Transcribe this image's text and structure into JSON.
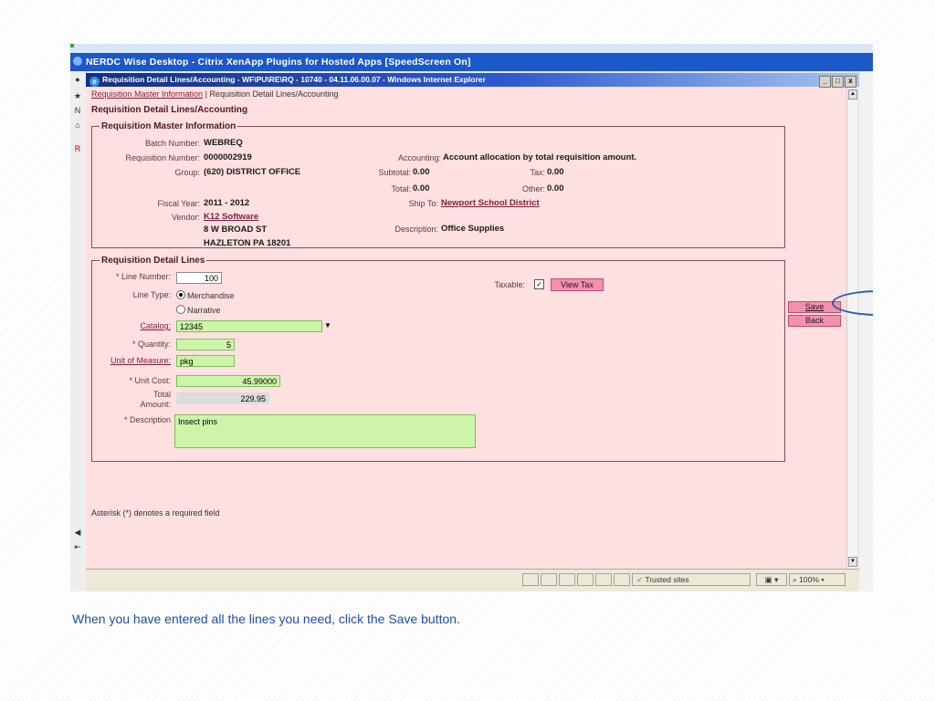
{
  "citrix": {
    "title": "NERDC Wise Desktop - Citrix XenApp Plugins for Hosted Apps [SpeedScreen On]"
  },
  "ie": {
    "title": "Requisition Detail Lines/Accounting - WF\\PU\\RE\\RQ - 10740 - 04.11.06.00.07 - Windows Internet Explorer"
  },
  "breadcrumb": {
    "link": "Requisition Master Information",
    "separator": "|",
    "current": "Requisition Detail Lines/Accounting"
  },
  "page_title": "Requisition Detail Lines/Accounting",
  "master": {
    "legend": "Requisition Master Information",
    "batch_label": "Batch Number:",
    "batch_value": "WEBREQ",
    "reqnum_label": "Requisition Number:",
    "reqnum_value": "0000002919",
    "group_label": "Group:",
    "group_value": "(620) DISTRICT OFFICE",
    "fiscal_label": "Fiscal Year:",
    "fiscal_value": "2011 - 2012",
    "vendor_label": "Vendor:",
    "vendor_value": "K12 Software",
    "vendor_addr1": "8 W BROAD ST",
    "vendor_addr2": "HAZLETON PA 18201",
    "accounting_label": "Accounting:",
    "accounting_value": "Account allocation by total requisition amount.",
    "subtotal_label": "Subtotal:",
    "subtotal_value": "0.00",
    "tax_label": "Tax:",
    "tax_value": "0.00",
    "total_label": "Total:",
    "total_value": "0.00",
    "other_label": "Other:",
    "other_value": "0.00",
    "shipto_label": "Ship To:",
    "shipto_value": "Newport School District",
    "desc_label": "Description:",
    "desc_value": "Office Supplies"
  },
  "detail": {
    "legend": "Requisition Detail Lines",
    "line_number_label": "* Line Number:",
    "line_number_value": "100",
    "line_type_label": "Line Type:",
    "merchandise_label": "Merchandise",
    "narrative_label": "Narrative",
    "line_type_selected": "Merchandise",
    "taxable_label": "Taxable:",
    "taxable_checked": true,
    "view_tax_button": "View Tax",
    "catalog_label": "Catalog:",
    "catalog_value": "12345",
    "quantity_label": "* Quantity:",
    "quantity_value": "5",
    "uom_label": "Unit of Measure:",
    "uom_value": "pkg",
    "unit_cost_label": "* Unit Cost:",
    "unit_cost_value": "45.99000",
    "total_amount_label_1": "Total",
    "total_amount_label_2": "Amount:",
    "total_amount_value": "229.95",
    "description_label": "* Description",
    "description_value": "Insect pins"
  },
  "actions": {
    "save": "Save",
    "back": "Back"
  },
  "footnote": "Asterisk (*) denotes a required field",
  "statusbar": {
    "zone": "Trusted sites",
    "zoom": "100%"
  },
  "caption": {
    "before": "When you have entered all the lines you need, click the",
    "bold": "Save",
    "after": "button."
  },
  "colors": {
    "page_bg": "#ffe0e0",
    "field_green": "#ccf5a8",
    "button_pink": "#f58fb0",
    "caption_blue": "#1f4ea8",
    "highlight_circle": "#2a5aa8"
  }
}
